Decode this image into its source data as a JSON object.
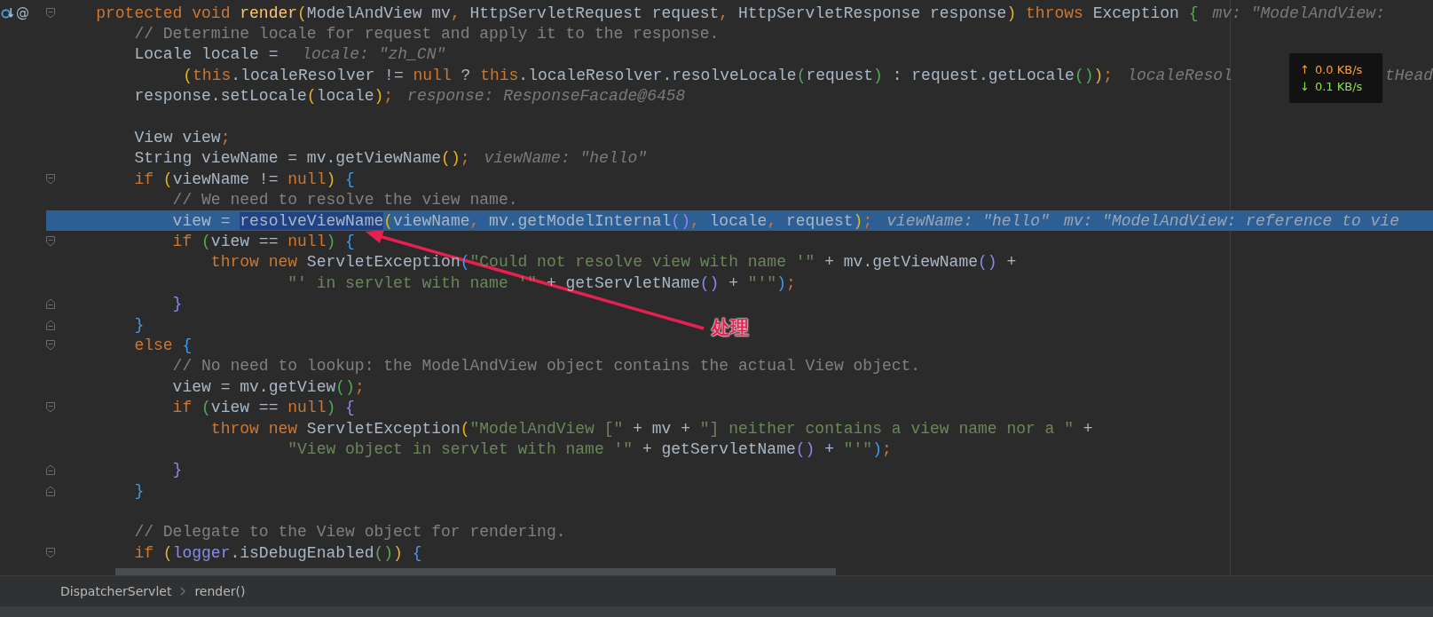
{
  "editor": {
    "lines": [
      {
        "gutter_icon": true,
        "gutter_text": "@",
        "kind": "opener",
        "current": false,
        "code": [
          {
            "t": "    protected void ",
            "kind": "kw"
          },
          {
            "t": "render",
            "kind": "fn"
          },
          {
            "t": "(",
            "kind": "p1"
          },
          {
            "t": "ModelAndView mv",
            "kind": "p"
          },
          {
            "t": ", ",
            "kind": "kw"
          },
          {
            "t": "HttpServletRequest request",
            "kind": "p"
          },
          {
            "t": ", ",
            "kind": "kw"
          },
          {
            "t": "HttpServletResponse response",
            "kind": "p"
          },
          {
            "t": ")",
            "kind": "p1"
          },
          {
            "t": " throws ",
            "kind": "kw"
          },
          {
            "t": "Exception ",
            "kind": "p"
          },
          {
            "t": "{",
            "kind": "p2"
          }
        ],
        "hints": [
          {
            "text": "mv: \"ModelAndView: ",
            "kind": "hint"
          }
        ]
      },
      {
        "kind": "plain",
        "current": false,
        "code": [
          {
            "t": "        // Determine locale for request and apply it to the response.",
            "kind": "cm"
          }
        ]
      },
      {
        "kind": "plain",
        "current": false,
        "code": [
          {
            "t": "        Locale locale = ",
            "kind": "p"
          }
        ],
        "hints": [
          {
            "text": "locale: \"zh_CN\"",
            "kind": "hint"
          }
        ]
      },
      {
        "kind": "plain",
        "current": false,
        "code": [
          {
            "t": "                (",
            "kind": "p1"
          },
          {
            "t": "this",
            "kind": "kw"
          },
          {
            "t": ".localeResolver != ",
            "kind": "p"
          },
          {
            "t": "null",
            "kind": "kw"
          },
          {
            "t": " ? ",
            "kind": "p"
          },
          {
            "t": "this",
            "kind": "kw"
          },
          {
            "t": ".localeResolver.resolveLocale",
            "kind": "p"
          },
          {
            "t": "(",
            "kind": "p2"
          },
          {
            "t": "request",
            "kind": "p"
          },
          {
            "t": ")",
            "kind": "p2"
          },
          {
            "t": " : request.getLocale",
            "kind": "p"
          },
          {
            "t": "()",
            "kind": "p2"
          },
          {
            "t": ")",
            "kind": "p1"
          },
          {
            "t": ";",
            "kind": "kw"
          }
        ],
        "hints": [
          {
            "text": "localeResol",
            "kind": "hint"
          },
          {
            "text": "tHead",
            "kind": "past-overlay"
          }
        ]
      },
      {
        "kind": "plain",
        "current": false,
        "code": [
          {
            "t": "        response.setLocale",
            "kind": "p"
          },
          {
            "t": "(",
            "kind": "p1"
          },
          {
            "t": "locale",
            "kind": "p"
          },
          {
            "t": ")",
            "kind": "p1"
          },
          {
            "t": ";",
            "kind": "kw"
          }
        ],
        "hints": [
          {
            "text": "response: ResponseFacade@6458",
            "kind": "hint"
          }
        ]
      },
      {
        "kind": "plain",
        "current": false
      },
      {
        "kind": "plain",
        "current": false,
        "code": [
          {
            "t": "        View view",
            "kind": "p"
          },
          {
            "t": ";",
            "kind": "kw"
          }
        ]
      },
      {
        "kind": "plain",
        "current": false,
        "code": [
          {
            "t": "        String viewName = mv.getViewName",
            "kind": "p"
          },
          {
            "t": "()",
            "kind": "p1"
          },
          {
            "t": ";",
            "kind": "kw"
          }
        ],
        "hints": [
          {
            "text": "viewName: \"hello\"",
            "kind": "hint"
          }
        ]
      },
      {
        "kind": "opener",
        "current": false,
        "code": [
          {
            "t": "        if ",
            "kind": "kw"
          },
          {
            "t": "(",
            "kind": "p1"
          },
          {
            "t": "viewName != ",
            "kind": "p"
          },
          {
            "t": "null",
            "kind": "kw"
          },
          {
            "t": ") ",
            "kind": "p1"
          },
          {
            "t": "{",
            "kind": "p3"
          }
        ]
      },
      {
        "kind": "plain",
        "current": false,
        "code": [
          {
            "t": "            // We need to resolve the view name.",
            "kind": "cm"
          }
        ]
      },
      {
        "kind": "plain",
        "current": true,
        "code": [
          {
            "t": "            view = ",
            "kind": "p"
          },
          {
            "t": "resolveViewName",
            "kind": "sel"
          },
          {
            "t": "(",
            "kind": "p1"
          },
          {
            "t": "viewName",
            "kind": "p"
          },
          {
            "t": ", ",
            "kind": "kw"
          },
          {
            "t": "mv.getModelInternal",
            "kind": "p"
          },
          {
            "t": "()",
            "kind": "p4"
          },
          {
            "t": ", ",
            "kind": "kw"
          },
          {
            "t": "locale",
            "kind": "p"
          },
          {
            "t": ", ",
            "kind": "kw"
          },
          {
            "t": "request",
            "kind": "p"
          },
          {
            "t": ")",
            "kind": "p1"
          },
          {
            "t": ";",
            "kind": "kw"
          }
        ],
        "hints": [
          {
            "text": "viewName: \"hello\"",
            "kind": "hint"
          },
          {
            "text": "mv: \"ModelAndView: reference to vie",
            "kind": "hint"
          }
        ]
      },
      {
        "kind": "opener",
        "current": false,
        "code": [
          {
            "t": "            if ",
            "kind": "kw"
          },
          {
            "t": "(",
            "kind": "p2"
          },
          {
            "t": "view == ",
            "kind": "p"
          },
          {
            "t": "null",
            "kind": "kw"
          },
          {
            "t": ") ",
            "kind": "p2"
          },
          {
            "t": "{",
            "kind": "p3"
          }
        ]
      },
      {
        "kind": "plain",
        "current": false,
        "code": [
          {
            "t": "                throw new ",
            "kind": "kw"
          },
          {
            "t": "ServletException",
            "kind": "p"
          },
          {
            "t": "(",
            "kind": "p3"
          },
          {
            "t": "\"Could not resolve view with name '\"",
            "kind": "str"
          },
          {
            "t": " + mv.getViewName",
            "kind": "p"
          },
          {
            "t": "()",
            "kind": "p4"
          },
          {
            "t": " +",
            "kind": "p"
          }
        ]
      },
      {
        "kind": "plain",
        "current": false,
        "code": [
          {
            "t": "                        \"' in servlet with name '\"",
            "kind": "str"
          },
          {
            "t": " + getServletName",
            "kind": "p"
          },
          {
            "t": "()",
            "kind": "p4"
          },
          {
            "t": " + ",
            "kind": "p"
          },
          {
            "t": "\"'\"",
            "kind": "str"
          },
          {
            "t": ")",
            "kind": "p3"
          },
          {
            "t": ";",
            "kind": "kw"
          }
        ]
      },
      {
        "kind": "closer",
        "current": false,
        "code": [
          {
            "t": "            }",
            "kind": "p4"
          }
        ]
      },
      {
        "kind": "closer",
        "current": false,
        "code": [
          {
            "t": "        }",
            "kind": "p3"
          }
        ]
      },
      {
        "kind": "opener",
        "current": false,
        "code": [
          {
            "t": "        else ",
            "kind": "kw"
          },
          {
            "t": "{",
            "kind": "p3"
          }
        ]
      },
      {
        "kind": "plain",
        "current": false,
        "code": [
          {
            "t": "            // No need to lookup: the ModelAndView object contains the actual View object.",
            "kind": "cm"
          }
        ]
      },
      {
        "kind": "plain",
        "current": false,
        "code": [
          {
            "t": "            view = mv.getView",
            "kind": "p"
          },
          {
            "t": "()",
            "kind": "p2"
          },
          {
            "t": ";",
            "kind": "kw"
          }
        ]
      },
      {
        "kind": "opener",
        "current": false,
        "code": [
          {
            "t": "            if ",
            "kind": "kw"
          },
          {
            "t": "(",
            "kind": "p2"
          },
          {
            "t": "view == ",
            "kind": "p"
          },
          {
            "t": "null",
            "kind": "kw"
          },
          {
            "t": ") ",
            "kind": "p2"
          },
          {
            "t": "{",
            "kind": "p4"
          }
        ]
      },
      {
        "kind": "plain",
        "current": false,
        "code": [
          {
            "t": "                throw new ",
            "kind": "kw"
          },
          {
            "t": "ServletException",
            "kind": "p"
          },
          {
            "t": "(",
            "kind": "p1"
          },
          {
            "t": "\"ModelAndView [\"",
            "kind": "str"
          },
          {
            "t": " + mv + ",
            "kind": "p"
          },
          {
            "t": "\"] neither contains a view name nor a \"",
            "kind": "str"
          },
          {
            "t": " +",
            "kind": "p"
          }
        ]
      },
      {
        "kind": "plain",
        "current": false,
        "code": [
          {
            "t": "                        \"View object in servlet with name '\"",
            "kind": "str"
          },
          {
            "t": " + getServletName",
            "kind": "p"
          },
          {
            "t": "()",
            "kind": "p4"
          },
          {
            "t": " + ",
            "kind": "p"
          },
          {
            "t": "\"'\"",
            "kind": "str"
          },
          {
            "t": ")",
            "kind": "p3"
          },
          {
            "t": ";",
            "kind": "kw"
          }
        ]
      },
      {
        "kind": "closer",
        "current": false,
        "code": [
          {
            "t": "            }",
            "kind": "p4"
          }
        ]
      },
      {
        "kind": "closer",
        "current": false,
        "code": [
          {
            "t": "        }",
            "kind": "p3"
          }
        ]
      },
      {
        "kind": "plain",
        "current": false
      },
      {
        "kind": "plain",
        "current": false,
        "code": [
          {
            "t": "        // Delegate to the View object for rendering.",
            "kind": "cm"
          }
        ]
      },
      {
        "kind": "opener",
        "current": false,
        "code": [
          {
            "t": "        if ",
            "kind": "kw"
          },
          {
            "t": "(",
            "kind": "p1"
          },
          {
            "t": "logger",
            "kind": "p4"
          },
          {
            "t": ".isDebugEnabled",
            "kind": "p"
          },
          {
            "t": "()",
            "kind": "p2"
          },
          {
            "t": ") ",
            "kind": "p1"
          },
          {
            "t": "{",
            "kind": "p3"
          }
        ]
      }
    ]
  },
  "annotation": {
    "label": "处理"
  },
  "network_overlay": [
    {
      "arrow": "↑",
      "rate": "0.0 KB/s",
      "color": "#f5a33a"
    },
    {
      "arrow": "↓",
      "rate": "0.1 KB/s",
      "color": "#8fe04a"
    }
  ],
  "breadcrumbs": [
    {
      "label": "DispatcherServlet"
    },
    {
      "label": "render()"
    }
  ]
}
